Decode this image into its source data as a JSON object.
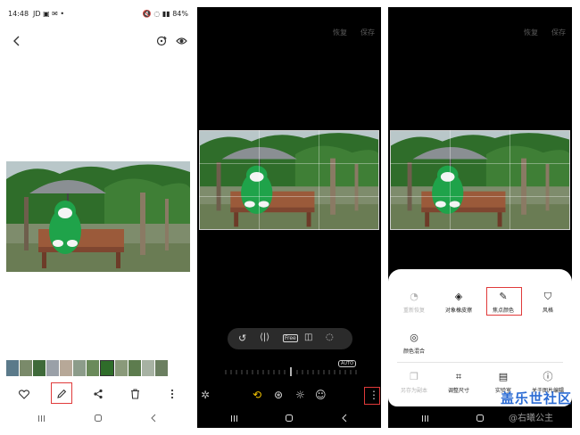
{
  "status_bar": {
    "time": "14:48",
    "indicators_left": "JD ▣ ✉ •",
    "indicators_right": "🔇 ◌ ▮▮ 84%",
    "battery": "84%"
  },
  "panel1": {
    "thumbnail_count": 12
  },
  "panel2": {
    "header": {
      "revert_label": "恢复",
      "save_label": "保存"
    },
    "auto_label": "AUTO",
    "aspect_free_label": "Free"
  },
  "panel3": {
    "header": {
      "revert_label": "恢复",
      "save_label": "保存"
    },
    "menu_row1": [
      {
        "label": "重新恢复",
        "icon": "restore-icon",
        "enabled": false
      },
      {
        "label": "对象橡皮擦",
        "icon": "eraser-icon",
        "enabled": true
      },
      {
        "label": "焦点颜色",
        "icon": "pen-icon",
        "enabled": true,
        "highlighted": true
      },
      {
        "label": "风格",
        "icon": "brush-icon",
        "enabled": true
      }
    ],
    "menu_row2": [
      {
        "label": "颜色混合",
        "icon": "palette-icon",
        "enabled": true
      }
    ],
    "menu_row3": [
      {
        "label": "另存为副本",
        "icon": "copy-icon",
        "enabled": false
      },
      {
        "label": "调整尺寸",
        "icon": "resize-icon",
        "enabled": true
      },
      {
        "label": "实验室",
        "icon": "lab-icon",
        "enabled": true
      },
      {
        "label": "关于图片编辑",
        "icon": "info-icon",
        "enabled": true
      }
    ]
  },
  "watermark": {
    "site": "盖乐世社区",
    "author": "@右曦公主"
  },
  "colors": {
    "highlight_red": "#e03a3a",
    "mascot_green": "#1fa34a",
    "tree_green": "#2f6d2a",
    "bench_brown": "#9b5a3a",
    "umbrella_gray": "#8a8f93"
  }
}
